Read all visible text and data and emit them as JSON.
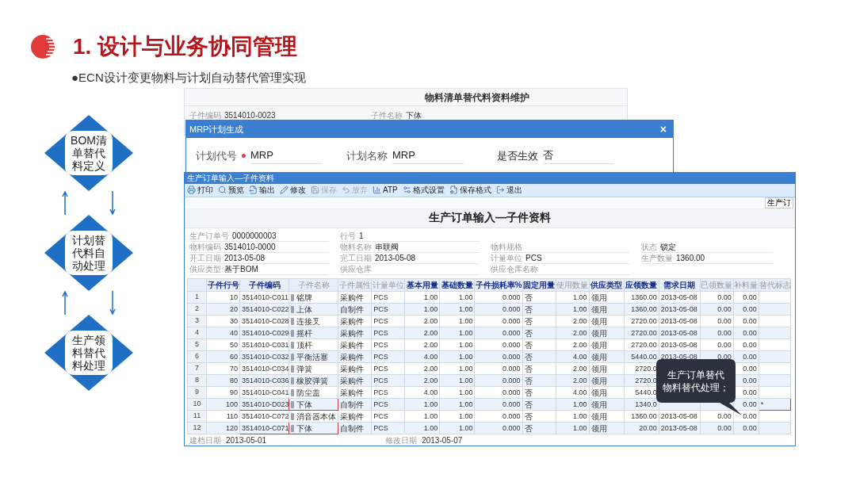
{
  "slide": {
    "title": "1. 设计与业务协同管理",
    "bullet": "●ECN设计变更物料与计划自动替代管理实现"
  },
  "flow": [
    {
      "lines": [
        "BOM清",
        "单替代",
        "料定义"
      ]
    },
    {
      "lines": [
        "计划替",
        "代料自",
        "动处理"
      ]
    },
    {
      "lines": [
        "生产领",
        "料替代",
        "料处理"
      ]
    }
  ],
  "background_window": {
    "title": "物料清单替代料资料维护",
    "fields": [
      {
        "label": "子件编码",
        "value": "3514010-0023"
      },
      {
        "label": "子件名称",
        "value": "下体"
      }
    ]
  },
  "mrp_dialog": {
    "title": "MRP计划生成",
    "close": "×",
    "fields": [
      {
        "label": "计划代号",
        "required": true,
        "value": "MRP"
      },
      {
        "label": "计划名称",
        "required": false,
        "value": "MRP"
      },
      {
        "label": "是否生效",
        "required": false,
        "value": "否"
      }
    ]
  },
  "order_window": {
    "title": "生产订单输入—子件资料",
    "toolbar": [
      {
        "label": "打印",
        "kind": "print",
        "disabled": false
      },
      {
        "label": "预览",
        "kind": "preview",
        "disabled": false
      },
      {
        "label": "输出",
        "kind": "export",
        "disabled": false
      },
      {
        "label": "修改",
        "kind": "edit",
        "disabled": false
      },
      {
        "label": "保存",
        "kind": "save",
        "disabled": true
      },
      {
        "label": "放弃",
        "kind": "discard",
        "disabled": true
      },
      {
        "label": "ATP",
        "kind": "atp",
        "disabled": false
      },
      {
        "label": "格式设置",
        "kind": "format",
        "disabled": false
      },
      {
        "label": "保存格式",
        "kind": "save_format",
        "disabled": false
      },
      {
        "label": "退出",
        "kind": "exit",
        "disabled": false
      }
    ],
    "corner_tab": "生产订",
    "heading": "生产订单输入—子件资料",
    "form": [
      [
        {
          "label": "生产订单号",
          "value": "0000000003"
        },
        {
          "label": "行号",
          "value": "1"
        }
      ],
      [
        {
          "label": "物料编码",
          "value": "3514010-0000"
        },
        {
          "label": "物料名称",
          "value": "串联阀"
        },
        {
          "label": "物料规格"
        },
        {
          "label": "状态",
          "value": "锁定"
        }
      ],
      [
        {
          "label": "开工日期",
          "value": "2013-05-08"
        },
        {
          "label": "完工日期",
          "value": "2013-05-08"
        },
        {
          "label": "计量单位",
          "value": "PCS"
        },
        {
          "label": "生产数量",
          "value": "1360.00"
        }
      ],
      [
        {
          "label": "供应类型",
          "value": "基于BOM"
        },
        {
          "label": "供应仓库"
        },
        {
          "label": "供应仓库名称"
        }
      ]
    ],
    "table": {
      "columns": [
        {
          "label": "子件行号",
          "emphasis": true
        },
        {
          "label": "子件编码",
          "emphasis": true
        },
        {
          "label": "子件名称",
          "emphasis": false
        },
        {
          "label": "子件属性",
          "emphasis": false
        },
        {
          "label": "计量单位",
          "emphasis": false
        },
        {
          "label": "基本用量",
          "emphasis": true
        },
        {
          "label": "基础数量",
          "emphasis": true
        },
        {
          "label": "子件损耗率%",
          "emphasis": true
        },
        {
          "label": "固定用量",
          "emphasis": true
        },
        {
          "label": "使用数量",
          "emphasis": false
        },
        {
          "label": "供应类型",
          "emphasis": true
        },
        {
          "label": "应领数量",
          "emphasis": true
        },
        {
          "label": "需求日期",
          "emphasis": true
        },
        {
          "label": "已领数量",
          "emphasis": false
        },
        {
          "label": "补料量",
          "emphasis": false
        },
        {
          "label": "替代标志",
          "emphasis": false
        }
      ],
      "rows": [
        {
          "num": "1",
          "marked": false,
          "cells": [
            "10",
            "3514010-C011",
            "铭牌",
            "采购件",
            "PCS",
            "1.00",
            "1.00",
            "0.000",
            "否",
            "1.00",
            "领用",
            "1360.00",
            "2013-05-08",
            "0.00",
            "0.00",
            null
          ]
        },
        {
          "num": "2",
          "marked": false,
          "cells": [
            "20",
            "3514010-C022",
            "上体",
            "自制件",
            "PCS",
            "1.00",
            "1.00",
            "0.000",
            "否",
            "1.00",
            "领用",
            "1360.00",
            "2013-05-08",
            "0.00",
            "0.00",
            null
          ]
        },
        {
          "num": "3",
          "marked": false,
          "cells": [
            "30",
            "3514010-C028",
            "连接叉",
            "采购件",
            "PCS",
            "2.00",
            "1.00",
            "0.000",
            "否",
            "2.00",
            "领用",
            "2720.00",
            "2013-05-08",
            "0.00",
            "0.00",
            null
          ]
        },
        {
          "num": "4",
          "marked": false,
          "cells": [
            "40",
            "3514010-C029",
            "摇杆",
            "采购件",
            "PCS",
            "2.00",
            "1.00",
            "0.000",
            "否",
            "2.00",
            "领用",
            "2720.00",
            "2013-05-08",
            "0.00",
            "0.00",
            null
          ]
        },
        {
          "num": "5",
          "marked": false,
          "cells": [
            "50",
            "3514010-C031",
            "顶杆",
            "采购件",
            "PCS",
            "2.00",
            "1.00",
            "0.000",
            "否",
            "2.00",
            "领用",
            "2720.00",
            "2013-05-08",
            "0.00",
            "0.00",
            null
          ]
        },
        {
          "num": "6",
          "marked": false,
          "cells": [
            "60",
            "3514010-C032",
            "平衡活塞",
            "采购件",
            "PCS",
            "4.00",
            "1.00",
            "0.000",
            "否",
            "4.00",
            "领用",
            "5440.00",
            "2013-05-08",
            "0.00",
            "0.00",
            null
          ]
        },
        {
          "num": "7",
          "marked": false,
          "cells": [
            "70",
            "3514010-C034",
            "弹簧",
            "采购件",
            "PCS",
            "2.00",
            "1.00",
            "0.000",
            "否",
            "2.00",
            "领用",
            "2720.0",
            null,
            null,
            "0.00",
            null
          ]
        },
        {
          "num": "8",
          "marked": false,
          "cells": [
            "80",
            "3514010-C036",
            "橡胶弹簧",
            "采购件",
            "PCS",
            "2.00",
            "1.00",
            "0.000",
            "否",
            "2.00",
            "领用",
            "2720.0",
            null,
            null,
            "0.00",
            null
          ]
        },
        {
          "num": "9",
          "marked": false,
          "cells": [
            "90",
            "3514010-C041",
            "防尘盖",
            "采购件",
            "PCS",
            "4.00",
            "1.00",
            "0.000",
            "否",
            "4.00",
            "领用",
            "5440.0",
            null,
            null,
            "0.00",
            null
          ]
        },
        {
          "num": "10",
          "marked": true,
          "cells": [
            "100",
            "3514010-D023",
            "下体",
            "自制件",
            "PCS",
            "1.00",
            "1.00",
            "0.000",
            "否",
            "1.00",
            "领用",
            "1340.0",
            null,
            null,
            "0.00",
            "*"
          ]
        },
        {
          "num": "11",
          "marked": false,
          "cells": [
            "110",
            "3514010-C072",
            "消音器本体",
            "采购件",
            "PCS",
            "1.00",
            "1.00",
            "0.000",
            "否",
            "1.00",
            "领用",
            "1360.00",
            "2013-05-08",
            "0.00",
            "0.00",
            null
          ]
        },
        {
          "num": "12",
          "marked": true,
          "cells": [
            "120",
            "3514010-C071",
            "下体",
            "自制件",
            "PCS",
            "1.00",
            "1.00",
            "0.000",
            "否",
            "1.00",
            "领用",
            "20.00",
            "2013-05-08",
            "0.00",
            "0.00",
            null
          ]
        }
      ]
    },
    "callout": [
      "生产订单替代",
      "物料替代处理；"
    ],
    "footer": [
      {
        "label": "建档日期",
        "value": "2013-05-01"
      },
      {
        "label": "修改日期",
        "value": "2013-05-07"
      }
    ]
  }
}
